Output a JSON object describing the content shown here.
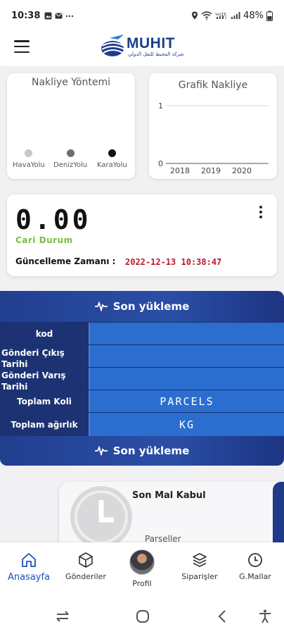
{
  "status_bar": {
    "time": "10:38",
    "left_icons": [
      "gallery-icon",
      "mail-icon",
      "more-icon"
    ],
    "right_icons": [
      "location-icon",
      "wifi-icon",
      "volte-icon",
      "signal-icon"
    ],
    "battery": "48%"
  },
  "header": {
    "brand": "MUHIT",
    "brand_subtitle": "شركة المحيط للنقل الدولي"
  },
  "shipping_method": {
    "title": "Nakliye Yöntemi",
    "items": [
      {
        "label": "HavaYolu",
        "color": "#c8c8c8"
      },
      {
        "label": "DenizYolu",
        "color": "#6e6e6e"
      },
      {
        "label": "KaraYolu",
        "color": "#111111"
      }
    ]
  },
  "chart_data": {
    "type": "line",
    "title": "Grafik Nakliye",
    "categories": [
      "2018",
      "2019",
      "2020"
    ],
    "y_ticks": [
      "1",
      "0"
    ],
    "ylim": [
      0,
      1
    ],
    "series": [],
    "grid": true
  },
  "status_card": {
    "value_digits": [
      "0",
      ".",
      "0",
      "0"
    ],
    "status_label": "Cari Durum",
    "update_label": "Güncelleme Zamanı :",
    "update_value": "2022-12-13 10:38:47"
  },
  "last_shipment": {
    "header": "Son yükleme",
    "footer": "Son yükleme",
    "rows": [
      {
        "key": "kod",
        "value": ""
      },
      {
        "key": "Gönderi Çıkış Tarihi",
        "value": ""
      },
      {
        "key": "Gönderi Varış Tarihi",
        "value": ""
      },
      {
        "key": "Toplam Koli",
        "value": "PARCELS"
      },
      {
        "key": "Toplam ağırlık",
        "value": "KG"
      }
    ]
  },
  "receipt": {
    "title": "Son Mal Kabul",
    "subtitle": "Parseller"
  },
  "bottom_nav": [
    {
      "label": "Anasayfa",
      "icon": "home-icon"
    },
    {
      "label": "Gönderiler",
      "icon": "box-icon"
    },
    {
      "label": "Profil",
      "icon": "avatar"
    },
    {
      "label": "Siparişler",
      "icon": "layers-icon"
    },
    {
      "label": "G.Mallar",
      "icon": "clock-icon"
    }
  ]
}
